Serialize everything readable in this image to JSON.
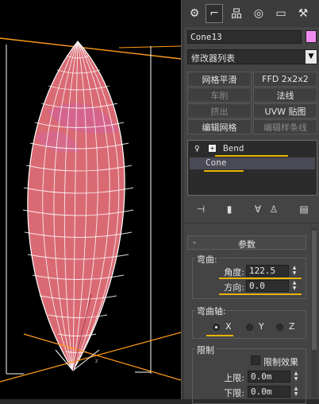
{
  "command_panel": {
    "tabs": [
      {
        "name": "create-tab",
        "glyph": "⚙"
      },
      {
        "name": "modify-tab",
        "glyph": "⌐"
      },
      {
        "name": "hierarchy-tab",
        "glyph": "品"
      },
      {
        "name": "motion-tab",
        "glyph": "◎"
      },
      {
        "name": "display-tab",
        "glyph": "▭"
      },
      {
        "name": "utilities-tab",
        "glyph": "⚒"
      }
    ],
    "object_name": "Cone13",
    "object_color": "#f28cf2",
    "modifier_list": "修改器列表",
    "modifier_buttons": [
      {
        "label": "网格平滑",
        "dim": false
      },
      {
        "label": "FFD 2x2x2",
        "dim": false
      },
      {
        "label": "车削",
        "dim": true
      },
      {
        "label": "法线",
        "dim": false
      },
      {
        "label": "挤出",
        "dim": true
      },
      {
        "label": "UVW 贴图",
        "dim": false
      },
      {
        "label": "编辑网格",
        "dim": false
      },
      {
        "label": "编辑样条线",
        "dim": true
      }
    ],
    "stack": [
      {
        "label": "Bend",
        "selected": false
      },
      {
        "label": "Cone",
        "selected": true
      }
    ],
    "stack_tools": [
      "pin-stack-icon",
      "show-end-result-icon",
      "make-unique-icon",
      "remove-modifier-icon",
      "configure-sets-icon"
    ]
  },
  "parameters": {
    "rollout_title": "参数",
    "bend_group": "弯曲:",
    "angle_label": "角度:",
    "angle_value": "122.5",
    "direction_label": "方向:",
    "direction_value": "0.0",
    "axis_group": "弯曲轴:",
    "axes": [
      "X",
      "Y",
      "Z"
    ],
    "axis_selected": "X",
    "limits_group": "限制",
    "limit_effect_label": "限制效果",
    "upper_label": "上限:",
    "upper_value": "0.0m",
    "lower_label": "下限:",
    "lower_value": "0.0m"
  },
  "colors": {
    "mesh_fill": "#d96a73",
    "wire": "#ffffff",
    "gizmo": "#ff9a1a",
    "highlight": "#e8b400"
  }
}
